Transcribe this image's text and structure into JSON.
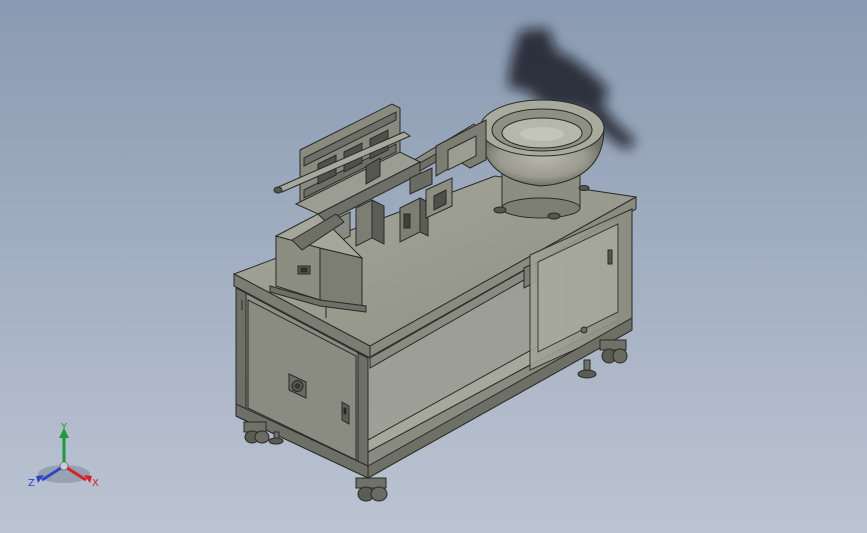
{
  "viewport": {
    "background_top": "#8a9ab2",
    "background_bottom": "#bcc4d2"
  },
  "model": {
    "type": "3D CAD assembly – machine cabinet with vibratory bowl feeder",
    "body_color": "#9a9b8e",
    "edge_color": "#2a2a26",
    "shadow_color": "#0d0f12"
  },
  "triad": {
    "x_label": "X",
    "y_label": "Y",
    "z_label": "Z",
    "x_color": "#d2242a",
    "y_color": "#1f9a3a",
    "z_color": "#2d46c6"
  }
}
